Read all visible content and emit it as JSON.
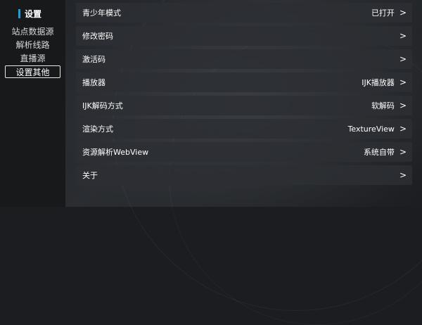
{
  "sidebar": {
    "title": "设置",
    "items": [
      {
        "label": "站点数据源"
      },
      {
        "label": "解析线路"
      },
      {
        "label": "直播源"
      },
      {
        "label": "设置其他"
      }
    ]
  },
  "rows": [
    {
      "label": "青少年模式",
      "value": "已打开",
      "chevron": ">"
    },
    {
      "label": "修改密码",
      "value": "",
      "chevron": ">"
    },
    {
      "label": "激活码",
      "value": "",
      "chevron": ">"
    },
    {
      "label": "播放器",
      "value": "IJK播放器",
      "chevron": ">"
    },
    {
      "label": "IJK解码方式",
      "value": "软解码",
      "chevron": ">"
    },
    {
      "label": "渲染方式",
      "value": "TextureView",
      "chevron": ">"
    },
    {
      "label": "资源解析WebView",
      "value": "系统自带",
      "chevron": ">"
    },
    {
      "label": "关于",
      "value": "",
      "chevron": ">"
    }
  ],
  "colors": {
    "accent": "#18a0d8"
  }
}
